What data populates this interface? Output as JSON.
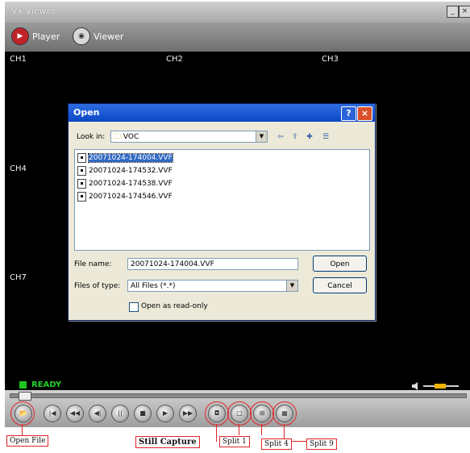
{
  "app": {
    "title": "Vx Viewer",
    "minimize_label": "_",
    "close_label": "×",
    "modes": [
      {
        "label": "Player",
        "icon": "play-icon"
      },
      {
        "label": "Viewer",
        "icon": "camera-icon"
      }
    ]
  },
  "channels": [
    "CH1",
    "CH2",
    "CH3",
    "CH4",
    "CH7"
  ],
  "status": {
    "text": "READY",
    "color": "#25d02a"
  },
  "dialog": {
    "title": "Open",
    "help_label": "?",
    "close_label": "×",
    "look_in_label": "Look in:",
    "look_in_value": "VOC",
    "files": [
      "20071024-174004.VVF",
      "20071024-174532.VVF",
      "20071024-174538.VVF",
      "20071024-174546.VVF"
    ],
    "selected_file": "20071024-174004.VVF",
    "file_name_label": "File name:",
    "file_name_value": "20071024-174004.VVF",
    "file_type_label": "Files of type:",
    "file_type_value": "All Files (*.*)",
    "open_button": "Open",
    "cancel_button": "Cancel",
    "read_only_label": "Open as read-only"
  },
  "callouts": {
    "open_file": "Open File",
    "still_capture": "Still Capture",
    "split1": "Split 1",
    "split4": "Split 4",
    "split9": "Split 9"
  },
  "colors": {
    "highlight": "#e0242a",
    "dialog_title": "#0b47c6",
    "status_led": "#1ec51e"
  }
}
